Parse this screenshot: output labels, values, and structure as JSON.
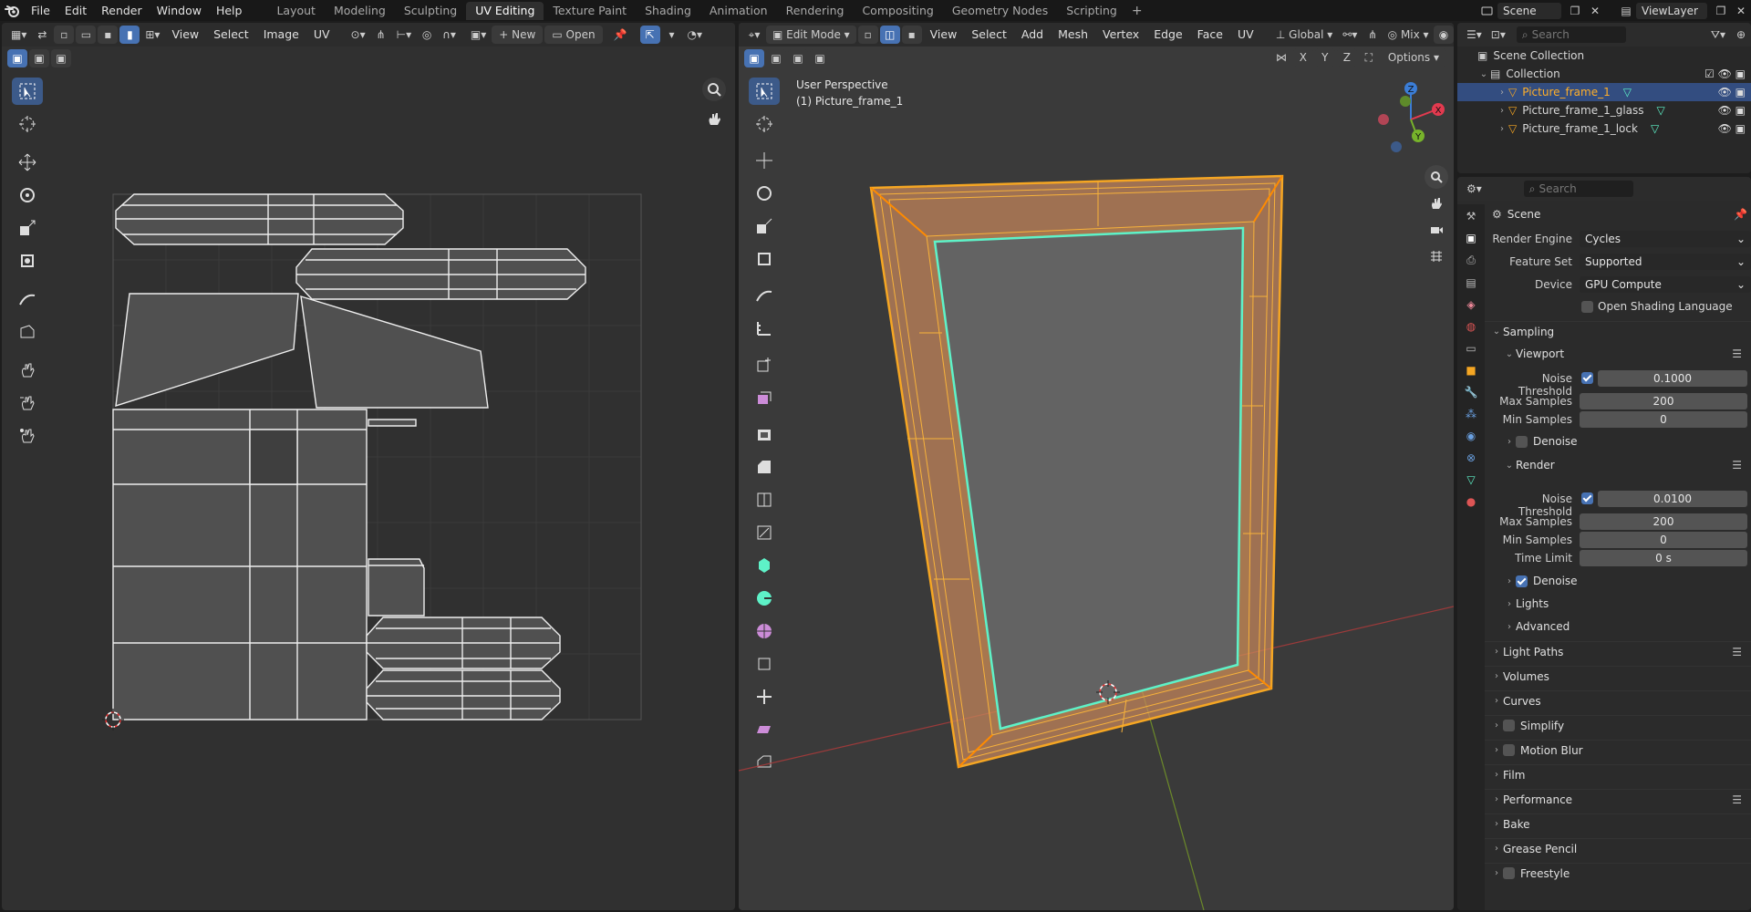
{
  "topbar": {
    "menus": [
      "File",
      "Edit",
      "Render",
      "Window",
      "Help"
    ],
    "workspaces": [
      "Layout",
      "Modeling",
      "Sculpting",
      "UV Editing",
      "Texture Paint",
      "Shading",
      "Animation",
      "Rendering",
      "Compositing",
      "Geometry Nodes",
      "Scripting"
    ],
    "active_workspace": "UV Editing",
    "scene": "Scene",
    "view_layer": "ViewLayer"
  },
  "uv_editor": {
    "menus": [
      "View",
      "Select",
      "Image",
      "UV"
    ],
    "new_label": "New",
    "open_label": "Open"
  },
  "viewport": {
    "mode": "Edit Mode",
    "menus": [
      "View",
      "Select",
      "Add",
      "Mesh",
      "Vertex",
      "Edge",
      "Face",
      "UV"
    ],
    "orientation": "Global",
    "shading": "Mix",
    "options_label": "Options",
    "axes": [
      "X",
      "Y",
      "Z"
    ],
    "overlay_title": "User Perspective",
    "overlay_object": "(1) Picture_frame_1"
  },
  "outliner": {
    "search_placeholder": "Search",
    "scene_collection": "Scene Collection",
    "collection": "Collection",
    "objects": [
      "Picture_frame_1",
      "Picture_frame_1_glass",
      "Picture_frame_1_lock"
    ]
  },
  "properties": {
    "search_placeholder": "Search",
    "context": "Scene",
    "render_engine_label": "Render Engine",
    "render_engine": "Cycles",
    "feature_set_label": "Feature Set",
    "feature_set": "Supported",
    "device_label": "Device",
    "device": "GPU Compute",
    "osl_label": "Open Shading Language",
    "sampling": "Sampling",
    "viewport": "Viewport",
    "noise_threshold_label": "Noise Threshold",
    "viewport_noise_threshold": "0.1000",
    "max_samples_label": "Max Samples",
    "viewport_max_samples": "200",
    "min_samples_label": "Min Samples",
    "viewport_min_samples": "0",
    "denoise_label": "Denoise",
    "render": "Render",
    "render_noise_threshold": "0.0100",
    "render_max_samples": "200",
    "render_min_samples": "0",
    "time_limit_label": "Time Limit",
    "time_limit": "0 s",
    "lights": "Lights",
    "advanced": "Advanced",
    "light_paths": "Light Paths",
    "volumes": "Volumes",
    "curves": "Curves",
    "simplify": "Simplify",
    "motion_blur": "Motion Blur",
    "film": "Film",
    "performance": "Performance",
    "bake": "Bake",
    "grease_pencil": "Grease Pencil",
    "freestyle": "Freestyle"
  },
  "colors": {
    "accent": "#4772b3",
    "selection_orange": "#f5a623",
    "active_edge": "#5ef2c8"
  }
}
